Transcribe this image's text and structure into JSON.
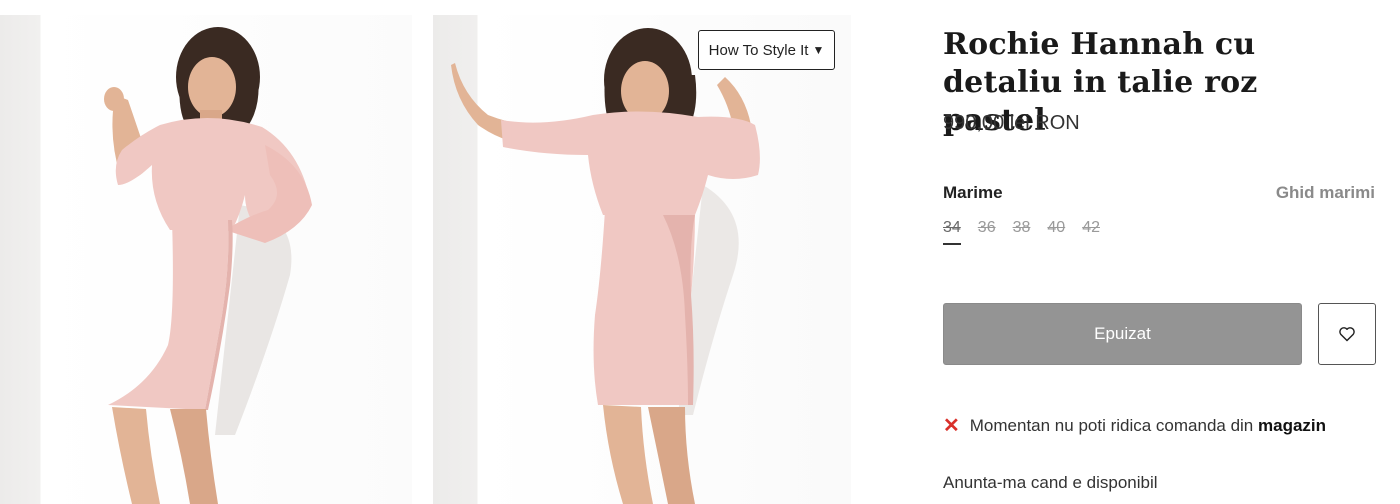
{
  "product": {
    "title": "Rochie Hannah cu detaliu in talie roz pastel",
    "price": "990,00 lei RON"
  },
  "gallery": {
    "style_button_label": "How To Style It",
    "style_button_caret": "▼"
  },
  "size_selector": {
    "label": "Marime",
    "guide_link": "Ghid marimi",
    "sizes": [
      "34",
      "36",
      "38",
      "40",
      "42"
    ],
    "selected": "34"
  },
  "actions": {
    "sold_out_label": "Epuizat",
    "wishlist_icon": "heart-icon"
  },
  "availability": {
    "pickup_icon": "x-icon",
    "pickup_text": "Momentan nu poti ridica comanda din",
    "pickup_place": "magazin",
    "notify_link": "Anunta-ma cand e disponibil"
  },
  "colors": {
    "sold_out_bg": "#949494",
    "error_icon": "#d9302a",
    "dress": "#f0c8c3"
  }
}
